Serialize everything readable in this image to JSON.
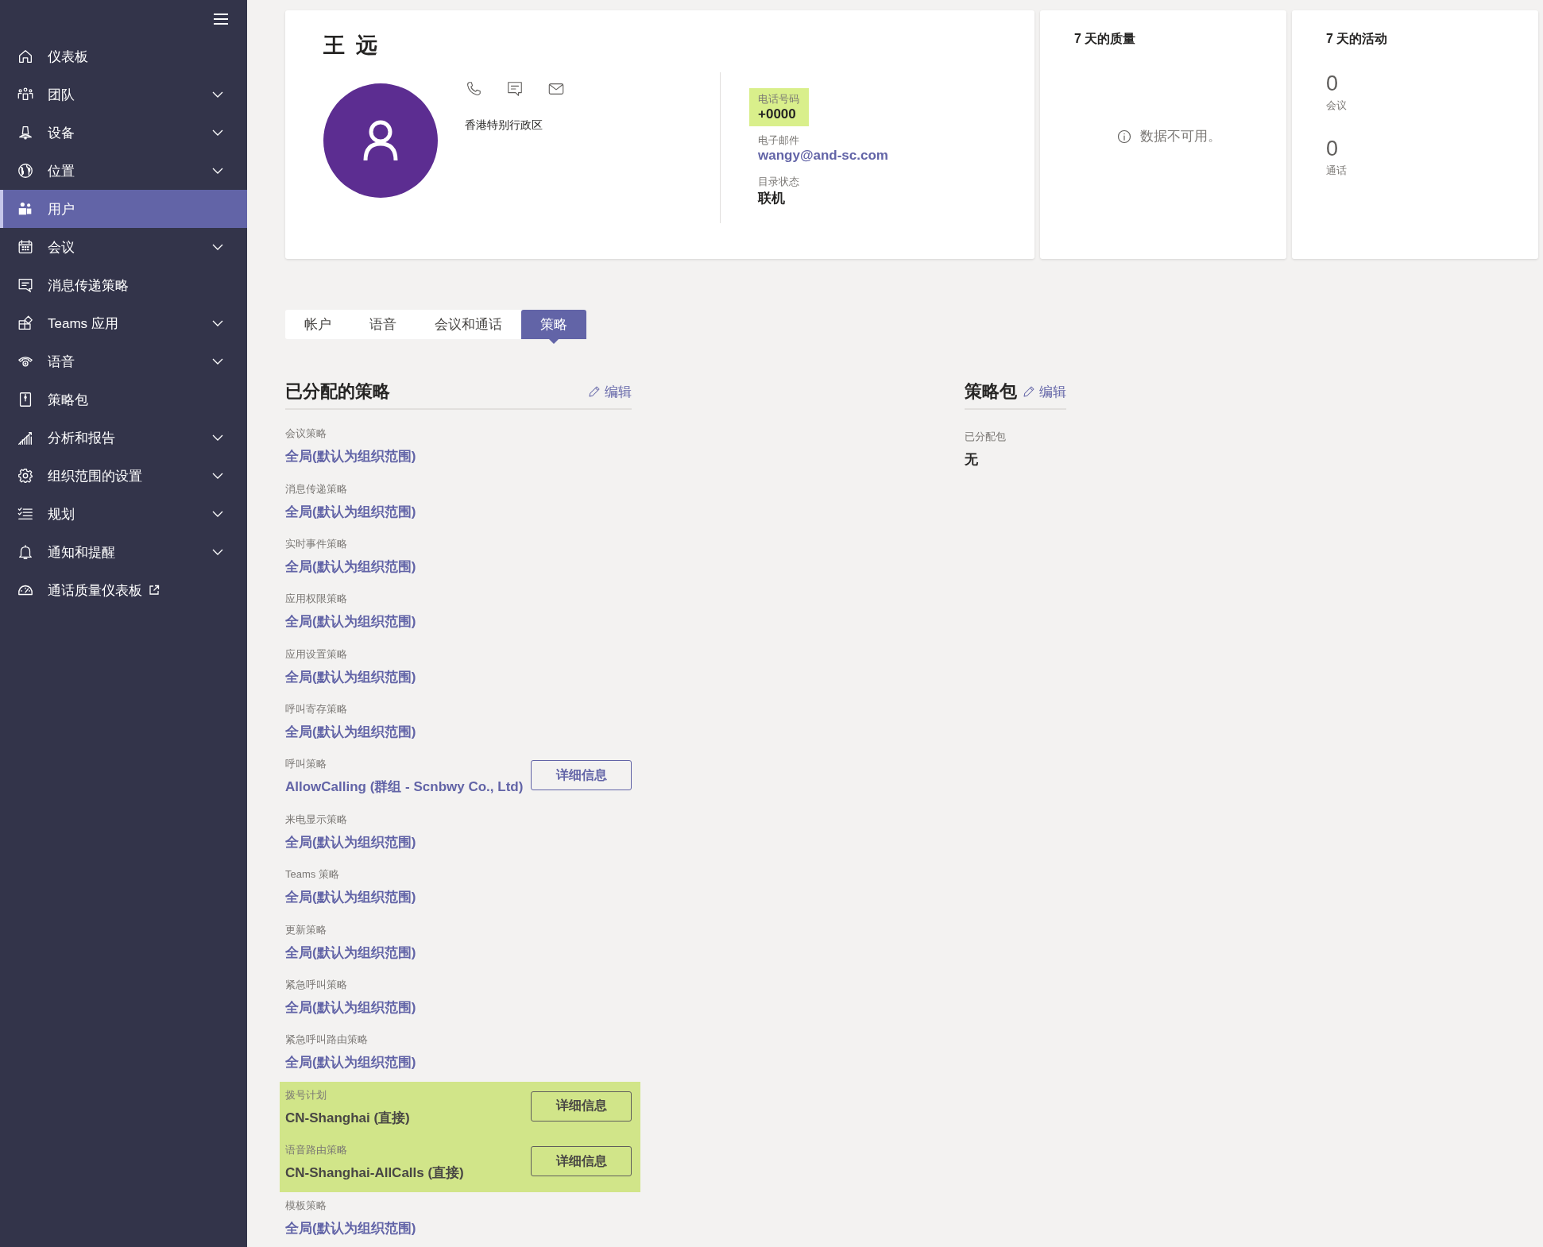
{
  "sidebar": {
    "items": [
      {
        "label": "仪表板",
        "expandable": false,
        "external": false,
        "selected": false
      },
      {
        "label": "团队",
        "expandable": true,
        "external": false,
        "selected": false
      },
      {
        "label": "设备",
        "expandable": true,
        "external": false,
        "selected": false
      },
      {
        "label": "位置",
        "expandable": true,
        "external": false,
        "selected": false
      },
      {
        "label": "用户",
        "expandable": false,
        "external": false,
        "selected": true
      },
      {
        "label": "会议",
        "expandable": true,
        "external": false,
        "selected": false
      },
      {
        "label": "消息传递策略",
        "expandable": false,
        "external": false,
        "selected": false
      },
      {
        "label": "Teams 应用",
        "expandable": true,
        "external": false,
        "selected": false
      },
      {
        "label": "语音",
        "expandable": true,
        "external": false,
        "selected": false
      },
      {
        "label": "策略包",
        "expandable": false,
        "external": false,
        "selected": false
      },
      {
        "label": "分析和报告",
        "expandable": true,
        "external": false,
        "selected": false
      },
      {
        "label": "组织范围的设置",
        "expandable": true,
        "external": false,
        "selected": false
      },
      {
        "label": "规划",
        "expandable": true,
        "external": false,
        "selected": false
      },
      {
        "label": "通知和提醒",
        "expandable": true,
        "external": false,
        "selected": false
      },
      {
        "label": "通话质量仪表板",
        "expandable": false,
        "external": true,
        "selected": false
      }
    ]
  },
  "profile": {
    "name": "王 远",
    "location": "香港特别行政区",
    "fields": [
      {
        "label": "电话号码",
        "value": "+0000",
        "kind": "text",
        "highlighted": true
      },
      {
        "label": "电子邮件",
        "value": "wangy@and-sc.com",
        "kind": "link",
        "highlighted": false
      },
      {
        "label": "目录状态",
        "value": "联机",
        "kind": "text",
        "highlighted": false
      }
    ]
  },
  "quality": {
    "title": "7 天的质量",
    "message": "数据不可用。"
  },
  "activity": {
    "title": "7 天的活动",
    "stats": [
      {
        "value": "0",
        "label": "会议"
      },
      {
        "value": "0",
        "label": "通话"
      }
    ]
  },
  "tabs": [
    {
      "label": "帐户",
      "selected": false
    },
    {
      "label": "语音",
      "selected": false
    },
    {
      "label": "会议和通话",
      "selected": false
    },
    {
      "label": "策略",
      "selected": true
    }
  ],
  "assigned_policies": {
    "title": "已分配的策略",
    "edit": "编辑",
    "items": [
      {
        "label": "会议策略",
        "value": "全局(默认为组织范围)",
        "highlighted": false
      },
      {
        "label": "消息传递策略",
        "value": "全局(默认为组织范围)",
        "highlighted": false
      },
      {
        "label": "实时事件策略",
        "value": "全局(默认为组织范围)",
        "highlighted": false
      },
      {
        "label": "应用权限策略",
        "value": "全局(默认为组织范围)",
        "highlighted": false
      },
      {
        "label": "应用设置策略",
        "value": "全局(默认为组织范围)",
        "highlighted": false
      },
      {
        "label": "呼叫寄存策略",
        "value": "全局(默认为组织范围)",
        "highlighted": false
      },
      {
        "label": "呼叫策略",
        "value": "AllowCalling (群组 - Scnbwy Co., Ltd)",
        "highlighted": false,
        "details": "详细信息"
      },
      {
        "label": "来电显示策略",
        "value": "全局(默认为组织范围)",
        "highlighted": false
      },
      {
        "label": "Teams 策略",
        "value": "全局(默认为组织范围)",
        "highlighted": false
      },
      {
        "label": "更新策略",
        "value": "全局(默认为组织范围)",
        "highlighted": false
      },
      {
        "label": "紧急呼叫策略",
        "value": "全局(默认为组织范围)",
        "highlighted": false
      },
      {
        "label": "紧急呼叫路由策略",
        "value": "全局(默认为组织范围)",
        "highlighted": false
      },
      {
        "label": "拨号计划",
        "value": "CN-Shanghai (直接)",
        "highlighted": true,
        "details": "详细信息"
      },
      {
        "label": "语音路由策略",
        "value": "CN-Shanghai-AllCalls (直接)",
        "highlighted": true,
        "details": "详细信息"
      },
      {
        "label": "模板策略",
        "value": "全局(默认为组织范围)",
        "highlighted": false
      }
    ]
  },
  "policy_package": {
    "title": "策略包",
    "edit": "编辑",
    "label": "已分配包",
    "value": "无"
  }
}
